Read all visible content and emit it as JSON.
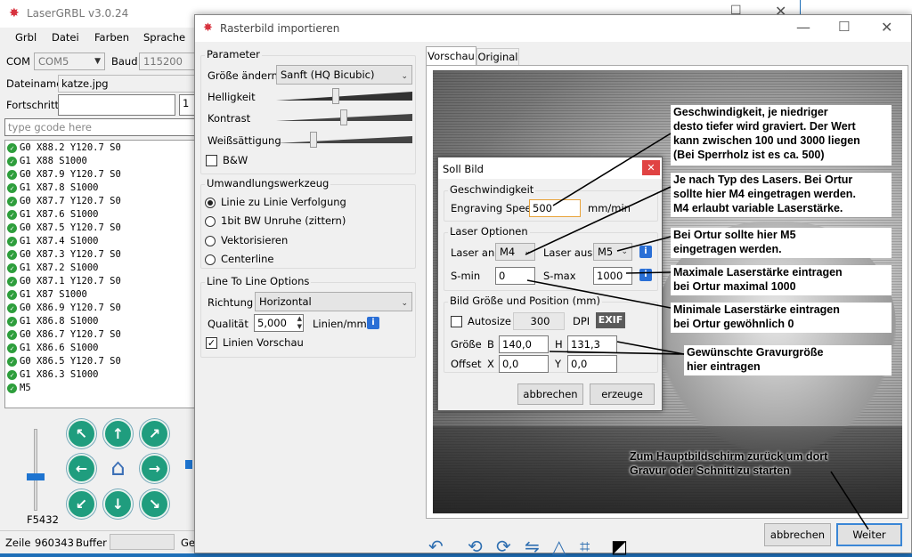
{
  "main_window": {
    "title": "LaserGRBL v3.0.24",
    "menu": [
      "Grbl",
      "Datei",
      "Farben",
      "Sprache"
    ],
    "com_label": "COM",
    "com_value": "COM5",
    "baud_label": "Baud",
    "baud_value": "115200",
    "file_label": "Dateiname",
    "file_value": "katze.jpg",
    "progress_label": "Fortschritt",
    "progress_value": "1",
    "gcode_placeholder": "type gcode here",
    "gcode_lines": [
      "G0 X88.2 Y120.7 S0",
      "G1 X88 S1000",
      "G0 X87.9 Y120.7 S0",
      "G1 X87.8 S1000",
      "G0 X87.7 Y120.7 S0",
      "G1 X87.6 S1000",
      "G0 X87.5 Y120.7 S0",
      "G1 X87.4 S1000",
      "G0 X87.3 Y120.7 S0",
      "G1 X87.2 S1000",
      "G0 X87.1 Y120.7 S0",
      "G1 X87 S1000",
      "G0 X86.9 Y120.7 S0",
      "G1 X86.8 S1000",
      "G0 X86.7 Y120.7 S0",
      "G1 X86.6 S1000",
      "G0 X86.5 Y120.7 S0",
      "G1 X86.3 S1000",
      "M5"
    ],
    "feed_label": "F5432",
    "status_row_label": "Zeile",
    "status_row_value": "960343",
    "status_buffer_label": "Buffer",
    "status_ge": "Ge"
  },
  "dialog": {
    "title": "Rasterbild importieren",
    "params_title": "Parameter",
    "resize_label": "Größe ändern",
    "resize_value": "Sanft (HQ Bicubic)",
    "brightness_label": "Helligkeit",
    "contrast_label": "Kontrast",
    "saturation_label": "Weißsättigung",
    "bw_label": "B&W",
    "conversion_title": "Umwandlungswerkzeug",
    "conversion_options": [
      "Linie zu Linie Verfolgung",
      "1bit BW Unruhe (zittern)",
      "Vektorisieren",
      "Centerline"
    ],
    "ltl_title": "Line To Line Options",
    "direction_label": "Richtung",
    "direction_value": "Horizontal",
    "quality_label": "Qualität",
    "quality_value": "5,000",
    "quality_unit": "Linien/mm",
    "preview_lines_label": "Linien Vorschau",
    "tabs": [
      "Vorschau",
      "Original"
    ],
    "cancel_label": "abbrechen",
    "next_label": "Weiter"
  },
  "soll": {
    "title": "Soll Bild",
    "speed_group": "Geschwindigkeit",
    "speed_label": "Engraving Speed",
    "speed_value": "500",
    "speed_unit": "mm/min",
    "laser_group": "Laser Optionen",
    "laser_on_label": "Laser an",
    "laser_on_value": "M4",
    "laser_off_label": "Laser aus",
    "laser_off_value": "M5",
    "smin_label": "S-min",
    "smin_value": "0",
    "smax_label": "S-max",
    "smax_value": "1000",
    "size_group": "Bild Größe und Position (mm)",
    "autosize_label": "Autosize",
    "dpi_value": "300",
    "dpi_label": "DPI",
    "exif_label": "EXIF",
    "size_label": "Größe",
    "b_label": "B",
    "b_value": "140,0",
    "h_label": "H",
    "h_value": "131,3",
    "offset_label": "Offset",
    "x_label": "X",
    "x_value": "0,0",
    "y_label": "Y",
    "y_value": "0,0",
    "cancel_label": "abbrechen",
    "create_label": "erzeuge"
  },
  "annotations": {
    "speed": [
      "Geschwindigkeit, je niedriger",
      "desto tiefer wird graviert. Der Wert",
      "kann zwischen 100 und 3000 liegen",
      "(Bei Sperrholz ist es ca. 500)"
    ],
    "laser_type": [
      "Je nach Typ des Lasers. Bei Ortur",
      "sollte hier M4 eingetragen werden.",
      "M4 erlaubt variable Laserstärke."
    ],
    "m5": [
      "Bei Ortur  sollte hier M5",
      "eingetragen werden."
    ],
    "max": [
      "Maximale Laserstärke eintragen",
      "bei Ortur maximal 1000"
    ],
    "min": [
      "Minimale  Laserstärke eintragen",
      "bei Ortur gewöhnlich 0"
    ],
    "size": [
      "Gewünschte Gravurgröße",
      "hier eintragen"
    ],
    "back": [
      "Zum Hauptbildschirm zurück um dort",
      "Gravur oder Schnitt zu starten"
    ]
  },
  "colors": {
    "accent": "#1e6fb8",
    "jog": "#1f9d7e",
    "info": "#2a6fd6",
    "speed_input_border": "#e8a33a"
  }
}
